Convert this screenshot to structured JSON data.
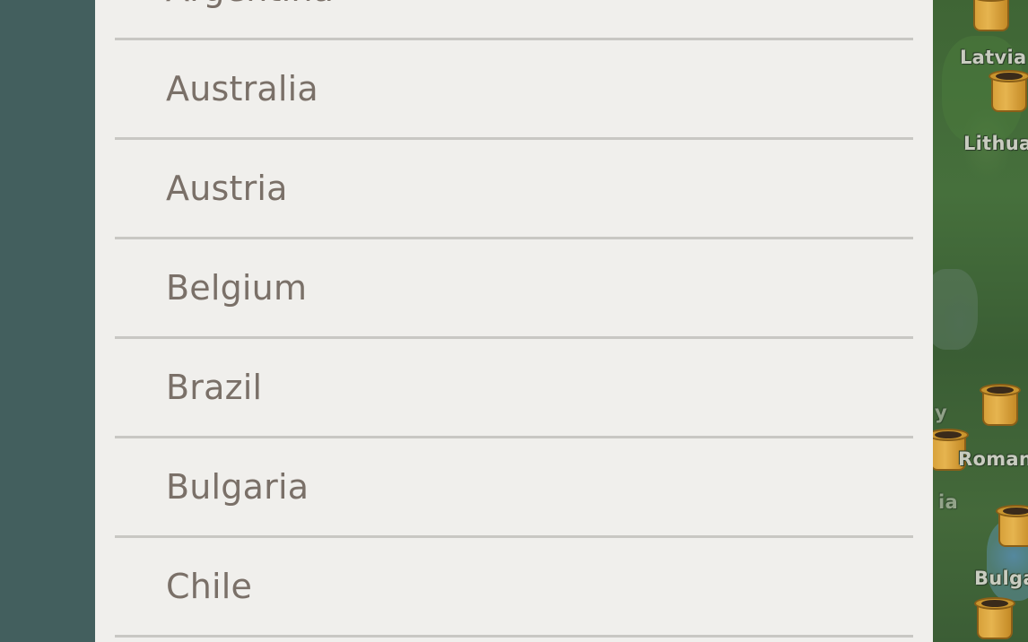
{
  "country_list": {
    "items": [
      {
        "label": "Argentina"
      },
      {
        "label": "Australia"
      },
      {
        "label": "Austria"
      },
      {
        "label": "Belgium"
      },
      {
        "label": "Brazil"
      },
      {
        "label": "Bulgaria"
      },
      {
        "label": "Chile"
      }
    ]
  },
  "map": {
    "labels": [
      "Latvia",
      "Lithua",
      "Roman",
      "Bulga"
    ],
    "faded_labels": [
      "y",
      "ia"
    ]
  },
  "colors": {
    "backdrop": "#435f5e",
    "panel": "#f0efec",
    "divider": "#c8c7c3",
    "item_text": "#7a7068",
    "pot": "#d7a13a"
  }
}
